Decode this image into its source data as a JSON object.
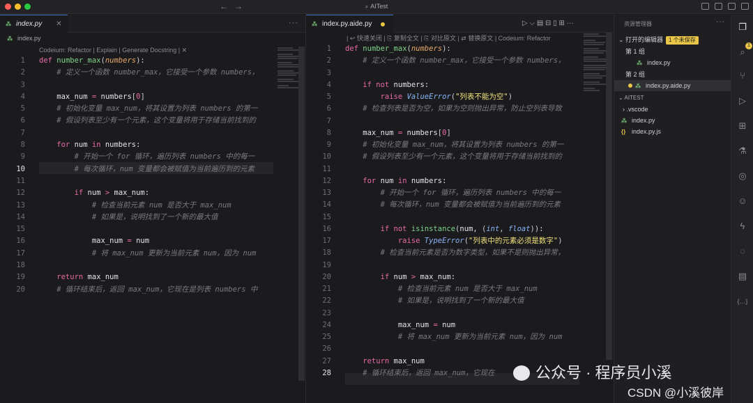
{
  "window": {
    "title": "AITest",
    "back_arrow": "←",
    "forward_arrow": "→"
  },
  "left": {
    "tab_label": "index.py",
    "tab_close": "✕",
    "more": "···",
    "breadcrumb": "index.py",
    "codelens": "Codeium: Refactor | Explain | Generate Docstring | ✕",
    "current_line": 10,
    "lines": [
      [
        [
          "kw",
          "def "
        ],
        [
          "fn",
          "number_max"
        ],
        [
          "pl",
          "("
        ],
        [
          "pm",
          "numbers"
        ],
        [
          "pl",
          "):"
        ]
      ],
      [
        [
          "cm",
          "    # 定义一个函数 number_max，它接受一个参数 numbers，"
        ]
      ],
      [],
      [
        [
          "tx",
          "    max_num "
        ],
        [
          "op",
          "= "
        ],
        [
          "tx",
          "numbers"
        ],
        [
          "pl",
          "["
        ],
        [
          "nm",
          "0"
        ],
        [
          "pl",
          "]"
        ]
      ],
      [
        [
          "cm",
          "    # 初始化变量 max_num，将其设置为列表 numbers 的第一"
        ]
      ],
      [
        [
          "cm",
          "    # 假设列表至少有一个元素，这个变量将用于存储当前找到的"
        ]
      ],
      [],
      [
        [
          "kw",
          "    for "
        ],
        [
          "tx",
          "num "
        ],
        [
          "kw",
          "in "
        ],
        [
          "tx",
          "numbers:"
        ]
      ],
      [
        [
          "cm",
          "        # 开始一个 for 循环，遍历列表 numbers 中的每一"
        ]
      ],
      [
        [
          "cm",
          "        # 每次循环，num 变量都会被赋值为当前遍历到的元素"
        ]
      ],
      [],
      [
        [
          "kw",
          "        if "
        ],
        [
          "tx",
          "num "
        ],
        [
          "op",
          "> "
        ],
        [
          "tx",
          "max_num:"
        ]
      ],
      [
        [
          "cm",
          "            # 检查当前元素 num 是否大于 max_num"
        ]
      ],
      [
        [
          "cm",
          "            # 如果是，说明找到了一个新的最大值"
        ]
      ],
      [],
      [
        [
          "tx",
          "            max_num "
        ],
        [
          "op",
          "= "
        ],
        [
          "tx",
          "num"
        ]
      ],
      [
        [
          "cm",
          "            # 将 max_num 更新为当前元素 num，因为 num"
        ]
      ],
      [],
      [
        [
          "kw",
          "    return "
        ],
        [
          "tx",
          "max_num"
        ]
      ],
      [
        [
          "cm",
          "    # 循环结束后，返回 max_num，它现在是列表 numbers 中"
        ]
      ]
    ]
  },
  "right": {
    "tab_label": "index.py.aide.py",
    "more": "···",
    "actions": "▷ ⌵ ▤ ⊟ ▯ ⊞ ···",
    "toolbar_text": "| ↩ 快速关闭 | ⎘ 复制全文 | ⎘ 对比原文 | ⇄ 替换原文 | Codeium: Refactor",
    "current_line": 28,
    "lines": [
      [
        [
          "kw",
          "def "
        ],
        [
          "fn",
          "number_max"
        ],
        [
          "pl",
          "("
        ],
        [
          "pm",
          "numbers"
        ],
        [
          "pl",
          "):"
        ]
      ],
      [
        [
          "cm",
          "    # 定义一个函数 number_max，它接受一个参数 numbers，"
        ]
      ],
      [],
      [
        [
          "kw",
          "    if not "
        ],
        [
          "tx",
          "numbers:"
        ]
      ],
      [
        [
          "kw",
          "        raise "
        ],
        [
          "cls",
          "ValueError"
        ],
        [
          "pl",
          "("
        ],
        [
          "str",
          "\"列表不能为空\""
        ],
        [
          "pl",
          ")"
        ]
      ],
      [
        [
          "cm",
          "    # 检查列表是否为空，如果为空则抛出异常，防止空列表导致"
        ]
      ],
      [],
      [
        [
          "tx",
          "    max_num "
        ],
        [
          "op",
          "= "
        ],
        [
          "tx",
          "numbers"
        ],
        [
          "pl",
          "["
        ],
        [
          "nm",
          "0"
        ],
        [
          "pl",
          "]"
        ]
      ],
      [
        [
          "cm",
          "    # 初始化变量 max_num，将其设置为列表 numbers 的第一"
        ]
      ],
      [
        [
          "cm",
          "    # 假设列表至少有一个元素，这个变量将用于存储当前找到的"
        ]
      ],
      [],
      [
        [
          "kw",
          "    for "
        ],
        [
          "tx",
          "num "
        ],
        [
          "kw",
          "in "
        ],
        [
          "tx",
          "numbers:"
        ]
      ],
      [
        [
          "cm",
          "        # 开始一个 for 循环，遍历列表 numbers 中的每一"
        ]
      ],
      [
        [
          "cm",
          "        # 每次循环，num 变量都会被赋值为当前遍历到的元素"
        ]
      ],
      [],
      [
        [
          "kw",
          "        if not "
        ],
        [
          "fn",
          "isinstance"
        ],
        [
          "pl",
          "("
        ],
        [
          "tx",
          "num, "
        ],
        [
          "pl",
          "("
        ],
        [
          "cls",
          "int"
        ],
        [
          "pl",
          ", "
        ],
        [
          "cls",
          "float"
        ],
        [
          "pl",
          "))"
        ],
        [
          "tx",
          ":"
        ]
      ],
      [
        [
          "kw",
          "            raise "
        ],
        [
          "cls",
          "TypeError"
        ],
        [
          "pl",
          "("
        ],
        [
          "str",
          "\"列表中的元素必须是数字\""
        ],
        [
          "pl",
          ")"
        ]
      ],
      [
        [
          "cm",
          "        # 检查当前元素是否为数字类型，如果不是则抛出异常，"
        ]
      ],
      [],
      [
        [
          "kw",
          "        if "
        ],
        [
          "tx",
          "num "
        ],
        [
          "op",
          "> "
        ],
        [
          "tx",
          "max_num:"
        ]
      ],
      [
        [
          "cm",
          "            # 检查当前元素 num 是否大于 max_num"
        ]
      ],
      [
        [
          "cm",
          "            # 如果是，说明找到了一个新的最大值"
        ]
      ],
      [],
      [
        [
          "tx",
          "            max_num "
        ],
        [
          "op",
          "= "
        ],
        [
          "tx",
          "num"
        ]
      ],
      [
        [
          "cm",
          "            # 将 max_num 更新为当前元素 num，因为 num"
        ]
      ],
      [],
      [
        [
          "kw",
          "    return "
        ],
        [
          "tx",
          "max_num"
        ]
      ],
      [
        [
          "cm",
          "    # 循环结束后，返回 max_num，它现在"
        ]
      ]
    ]
  },
  "explorer": {
    "title": "资源管理器",
    "more": "···",
    "open_editors": "打开的编辑器",
    "unsaved_badge": "1 个未保存",
    "group1": "第 1 组",
    "group1_file": "index.py",
    "group2": "第 2 组",
    "group2_file": "index.py.aide.py",
    "project": "AITEST",
    "items": [
      ".vscode",
      "index.py",
      "index.py.js"
    ]
  },
  "activity_badge": "1",
  "watermark": {
    "line1": "公众号 · 程序员小溪",
    "line2": "CSDN @小溪彼岸"
  }
}
